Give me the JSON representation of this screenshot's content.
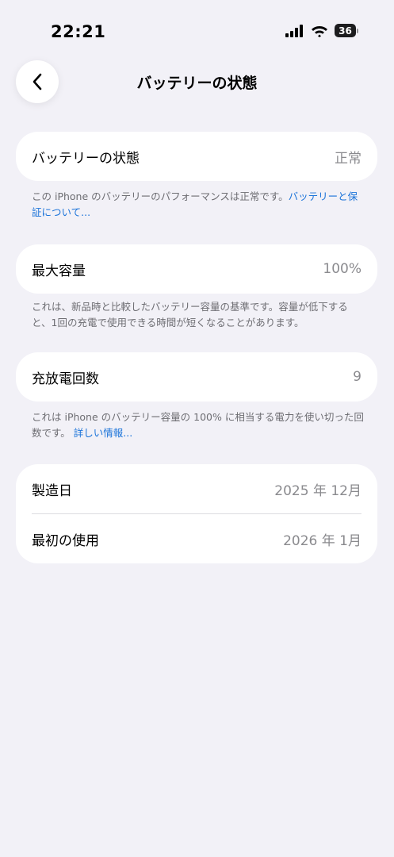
{
  "status_bar": {
    "time": "22:21",
    "battery_level": "36"
  },
  "nav": {
    "title": "バッテリーの状態"
  },
  "health": {
    "label": "バッテリーの状態",
    "value": "正常",
    "footnote": "この iPhone のバッテリーのパフォーマンスは正常です。",
    "footnote_link": "バッテリーと保証について..."
  },
  "capacity": {
    "label": "最大容量",
    "value": "100%",
    "footnote": "これは、新品時と比較したバッテリー容量の基準です。容量が低下すると、1回の充電で使用できる時間が短くなることがあります。"
  },
  "cycles": {
    "label": "充放電回数",
    "value": "9",
    "footnote": "これは iPhone のバッテリー容量の 100% に相当する電力を使い切った回数です。",
    "footnote_link": "詳しい情報..."
  },
  "dates": {
    "manufacture_label": "製造日",
    "manufacture_value": "2025 年 12月",
    "first_use_label": "最初の使用",
    "first_use_value": "2026 年 1月"
  }
}
